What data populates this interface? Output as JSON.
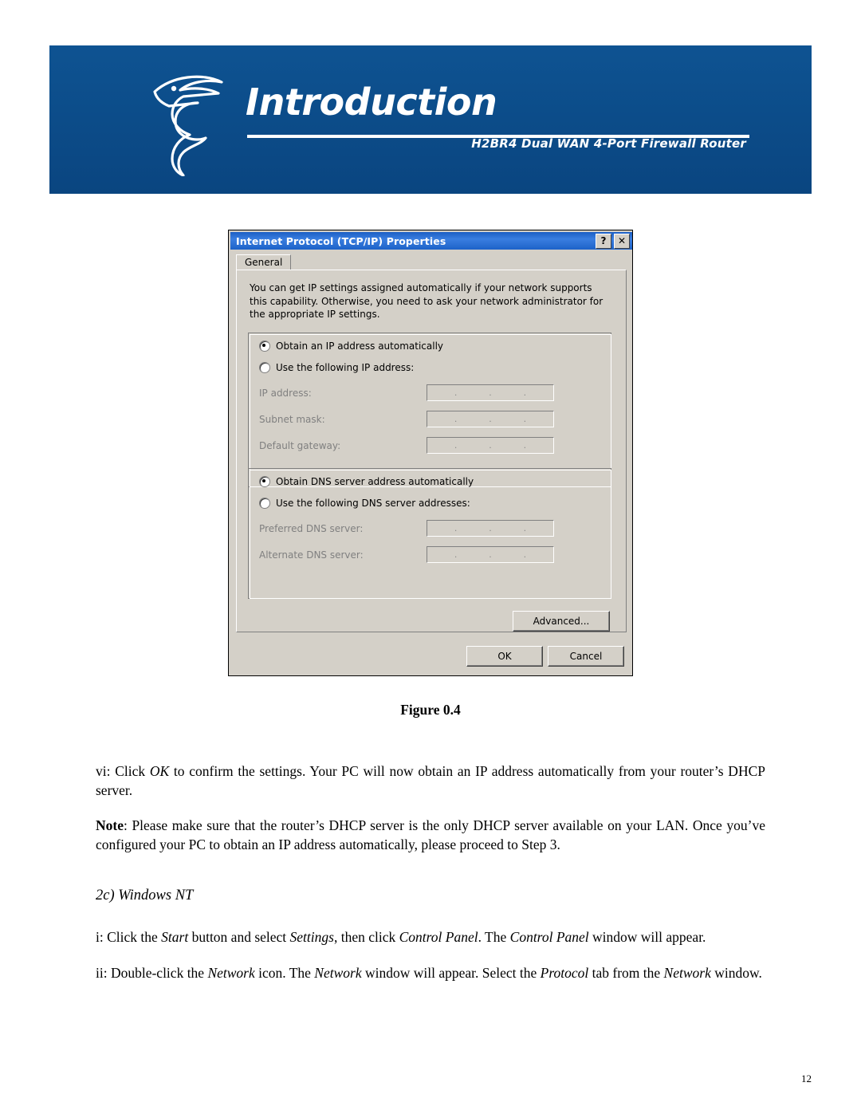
{
  "banner": {
    "title": "Introduction",
    "subtitle": "H2BR4  Dual WAN 4-Port Firewall Router"
  },
  "dialog": {
    "title": "Internet Protocol (TCP/IP) Properties",
    "help_button": "?",
    "close_button": "✕",
    "tab": "General",
    "description": "You can get IP settings assigned automatically if your network supports this capability. Otherwise, you need to ask your network administrator for the appropriate IP settings.",
    "radio_auto_ip": "Obtain an IP address automatically",
    "radio_manual_ip": "Use the following IP address:",
    "label_ip": "IP address:",
    "label_subnet": "Subnet mask:",
    "label_gateway": "Default gateway:",
    "radio_auto_dns": "Obtain DNS server address automatically",
    "radio_manual_dns": "Use the following DNS server addresses:",
    "label_preferred_dns": "Preferred DNS server:",
    "label_alternate_dns": "Alternate DNS server:",
    "ip_value": "",
    "subnet_value": "",
    "gateway_value": "",
    "preferred_dns_value": "",
    "alternate_dns_value": "",
    "btn_advanced": "Advanced...",
    "btn_ok": "OK",
    "btn_cancel": "Cancel",
    "dot": "."
  },
  "figure_caption": "Figure 0.4",
  "body": {
    "para_vi_prefix": "vi: Click ",
    "para_vi_ok": "OK",
    "para_vi_rest": " to confirm the settings.  Your PC will now obtain an IP address automatically from your router’s DHCP server.",
    "note_label": "Note",
    "note_text": ": Please make sure that the router’s DHCP server is the only DHCP server available on your LAN.  Once you’ve configured your PC to obtain an IP address automatically, please proceed to Step 3.",
    "section_heading": "2c) Windows NT",
    "step_i": {
      "a": "i: Click the ",
      "start": "Start",
      "b": " button and select ",
      "settings": "Settings",
      "c": ", then click ",
      "control_panel": "Control Panel",
      "d": ". The ",
      "control_panel2": "Control Panel",
      "e": " window will appear."
    },
    "step_ii": {
      "a": "ii: Double-click the ",
      "network": "Network",
      "b": " icon.  The ",
      "network2": "Network",
      "c": " window will appear.  Select the ",
      "protocol": "Protocol",
      "d": " tab from the ",
      "network3": "Network",
      "e": " window."
    }
  },
  "page_number": "12"
}
